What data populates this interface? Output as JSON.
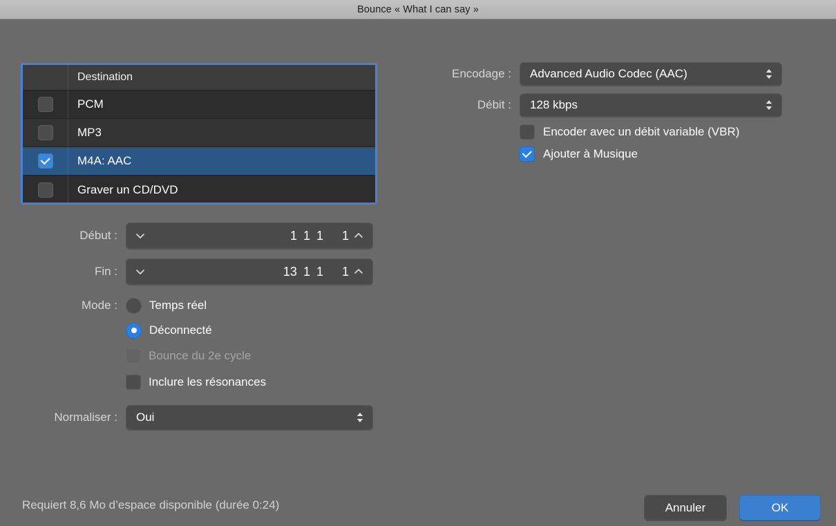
{
  "window": {
    "title": "Bounce « What I can say »"
  },
  "destination": {
    "header": "Destination",
    "rows": [
      {
        "label": "PCM",
        "checked": false
      },
      {
        "label": "MP3",
        "checked": false
      },
      {
        "label": "M4A: AAC",
        "checked": true
      },
      {
        "label": "Graver un CD/DVD",
        "checked": false
      }
    ]
  },
  "encoding": {
    "encodage_label": "Encodage :",
    "encodage_value": "Advanced Audio Codec (AAC)",
    "debit_label": "Débit :",
    "debit_value": "128 kbps",
    "vbr_label": "Encoder avec un débit variable (VBR)",
    "vbr_checked": false,
    "add_music_label": "Ajouter à Musique",
    "add_music_checked": true
  },
  "position": {
    "debut_label": "Début :",
    "debut": {
      "bar": "1",
      "beat": "1",
      "division": "1",
      "tick": "1"
    },
    "fin_label": "Fin :",
    "fin": {
      "bar": "13",
      "beat": "1",
      "division": "1",
      "tick": "1"
    }
  },
  "mode": {
    "label": "Mode :",
    "realtime_label": "Temps réel",
    "realtime_selected": false,
    "offline_label": "Déconnecté",
    "offline_selected": true,
    "second_cycle_label": "Bounce du 2e cycle",
    "second_cycle_checked": false,
    "second_cycle_disabled": true,
    "tails_label": "Inclure les résonances",
    "tails_checked": false
  },
  "normalize": {
    "label": "Normaliser :",
    "value": "Oui"
  },
  "footer": {
    "status": "Requiert 8,6 Mo d’espace disponible (durée 0:24)",
    "cancel_label": "Annuler",
    "ok_label": "OK"
  },
  "colors": {
    "accent_blue": "#2a7fe0",
    "selected_row": "#2b5786",
    "focus_ring": "#4a7fd4",
    "window_bg": "#6a6a6a",
    "control_bg": "#4a4a4a"
  }
}
